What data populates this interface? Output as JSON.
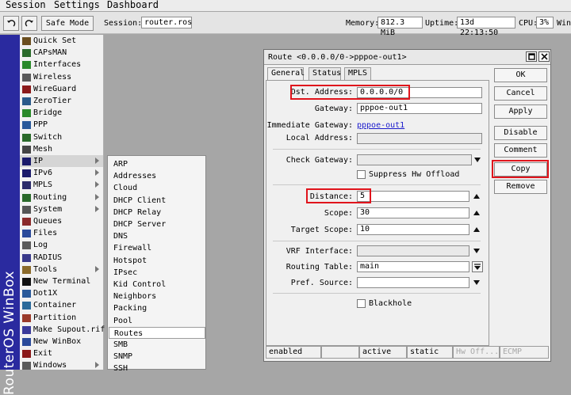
{
  "menubar": {
    "items": [
      "Session",
      "Settings",
      "Dashboard"
    ]
  },
  "toolbar": {
    "undo_icon": "undo-icon",
    "redo_icon": "redo-icon",
    "safe_mode_label": "Safe Mode",
    "session_label": "Session:",
    "session_value": "router.ros",
    "memory_label": "Memory:",
    "memory_value": "812.3 MiB",
    "uptime_label": "Uptime:",
    "uptime_value": "13d 22:13:50",
    "cpu_label": "CPU:",
    "cpu_value": "3%",
    "partial_label": "Win"
  },
  "brand": {
    "text": "RouterOS WinBox"
  },
  "sidebar": {
    "items": [
      {
        "label": "Quick Set",
        "icon": "quick-set-icon",
        "color": "#6b4e1f"
      },
      {
        "label": "CAPsMAN",
        "icon": "capsman-icon",
        "color": "#2b6b2b"
      },
      {
        "label": "Interfaces",
        "icon": "interfaces-icon",
        "color": "#2a8a2a"
      },
      {
        "label": "Wireless",
        "icon": "wireless-icon",
        "color": "#5a5a5a"
      },
      {
        "label": "WireGuard",
        "icon": "wireguard-icon",
        "color": "#8b1a1a"
      },
      {
        "label": "ZeroTier",
        "icon": "zerotier-icon",
        "color": "#2a5a8a"
      },
      {
        "label": "Bridge",
        "icon": "bridge-icon",
        "color": "#2a8a2a"
      },
      {
        "label": "PPP",
        "icon": "ppp-icon",
        "color": "#2a5a9a"
      },
      {
        "label": "Switch",
        "icon": "switch-icon",
        "color": "#2a6a2a"
      },
      {
        "label": "Mesh",
        "icon": "mesh-icon",
        "color": "#444444"
      },
      {
        "label": "IP",
        "icon": "ip-icon",
        "color": "#1a1a6a",
        "arrow": true
      },
      {
        "label": "IPv6",
        "icon": "ipv6-icon",
        "color": "#1a1a6a",
        "arrow": true
      },
      {
        "label": "MPLS",
        "icon": "mpls-icon",
        "color": "#2a2a6a",
        "arrow": true
      },
      {
        "label": "Routing",
        "icon": "routing-icon",
        "color": "#2a6a2a",
        "arrow": true
      },
      {
        "label": "System",
        "icon": "system-icon",
        "color": "#555555",
        "arrow": true
      },
      {
        "label": "Queues",
        "icon": "queues-icon",
        "color": "#8a2a2a"
      },
      {
        "label": "Files",
        "icon": "files-icon",
        "color": "#2a4a9a"
      },
      {
        "label": "Log",
        "icon": "log-icon",
        "color": "#5a5a5a"
      },
      {
        "label": "RADIUS",
        "icon": "radius-icon",
        "color": "#3a3a8a"
      },
      {
        "label": "Tools",
        "icon": "tools-icon",
        "color": "#8a6a2a",
        "arrow": true
      },
      {
        "label": "New Terminal",
        "icon": "terminal-icon",
        "color": "#111111"
      },
      {
        "label": "Dot1X",
        "icon": "dot1x-icon",
        "color": "#2a5a9a"
      },
      {
        "label": "Container",
        "icon": "container-icon",
        "color": "#2a6a9a"
      },
      {
        "label": "Partition",
        "icon": "partition-icon",
        "color": "#9a3a2a"
      },
      {
        "label": "Make Supout.rif",
        "icon": "supout-icon",
        "color": "#3a3a9a"
      },
      {
        "label": "New WinBox",
        "icon": "winbox-icon",
        "color": "#2a4a9a"
      },
      {
        "label": "Exit",
        "icon": "exit-icon",
        "color": "#8a1a1a"
      },
      {
        "label": "Windows",
        "icon": "windows-icon",
        "color": "#5a5a5a",
        "arrow": true
      }
    ]
  },
  "submenu": {
    "items": [
      "ARP",
      "Addresses",
      "Cloud",
      "DHCP Client",
      "DHCP Relay",
      "DHCP Server",
      "DNS",
      "Firewall",
      "Hotspot",
      "IPsec",
      "Kid Control",
      "Neighbors",
      "Packing",
      "Pool",
      "Routes",
      "SMB",
      "SNMP",
      "SSH"
    ],
    "selected": "Routes"
  },
  "route_window": {
    "title": "Route <0.0.0.0/0->pppoe-out1>",
    "restore_icon": "restore-icon",
    "close_icon": "close-icon",
    "tabs": [
      "General",
      "Status",
      "MPLS"
    ],
    "fields": {
      "dst_address_label": "Dst. Address:",
      "dst_address_value": "0.0.0.0/0",
      "gateway_label": "Gateway:",
      "gateway_value": "pppoe-out1",
      "immediate_gateway_label": "Immediate Gateway:",
      "immediate_gateway_value": "pppoe-out1",
      "local_address_label": "Local Address:",
      "local_address_value": "",
      "check_gateway_label": "Check Gateway:",
      "check_gateway_value": "",
      "suppress_hw_offload_label": "Suppress Hw Offload",
      "distance_label": "Distance:",
      "distance_value": "5",
      "scope_label": "Scope:",
      "scope_value": "30",
      "target_scope_label": "Target Scope:",
      "target_scope_value": "10",
      "vrf_interface_label": "VRF Interface:",
      "vrf_interface_value": "",
      "routing_table_label": "Routing Table:",
      "routing_table_value": "main",
      "pref_source_label": "Pref. Source:",
      "pref_source_value": "",
      "blackhole_label": "Blackhole"
    },
    "buttons": [
      "OK",
      "Cancel",
      "Apply",
      "Disable",
      "Comment",
      "Copy",
      "Remove"
    ],
    "status": [
      "enabled",
      "",
      "active",
      "static",
      "Hw Off...",
      "ECMP"
    ],
    "highlight_color": "#e0141c"
  }
}
